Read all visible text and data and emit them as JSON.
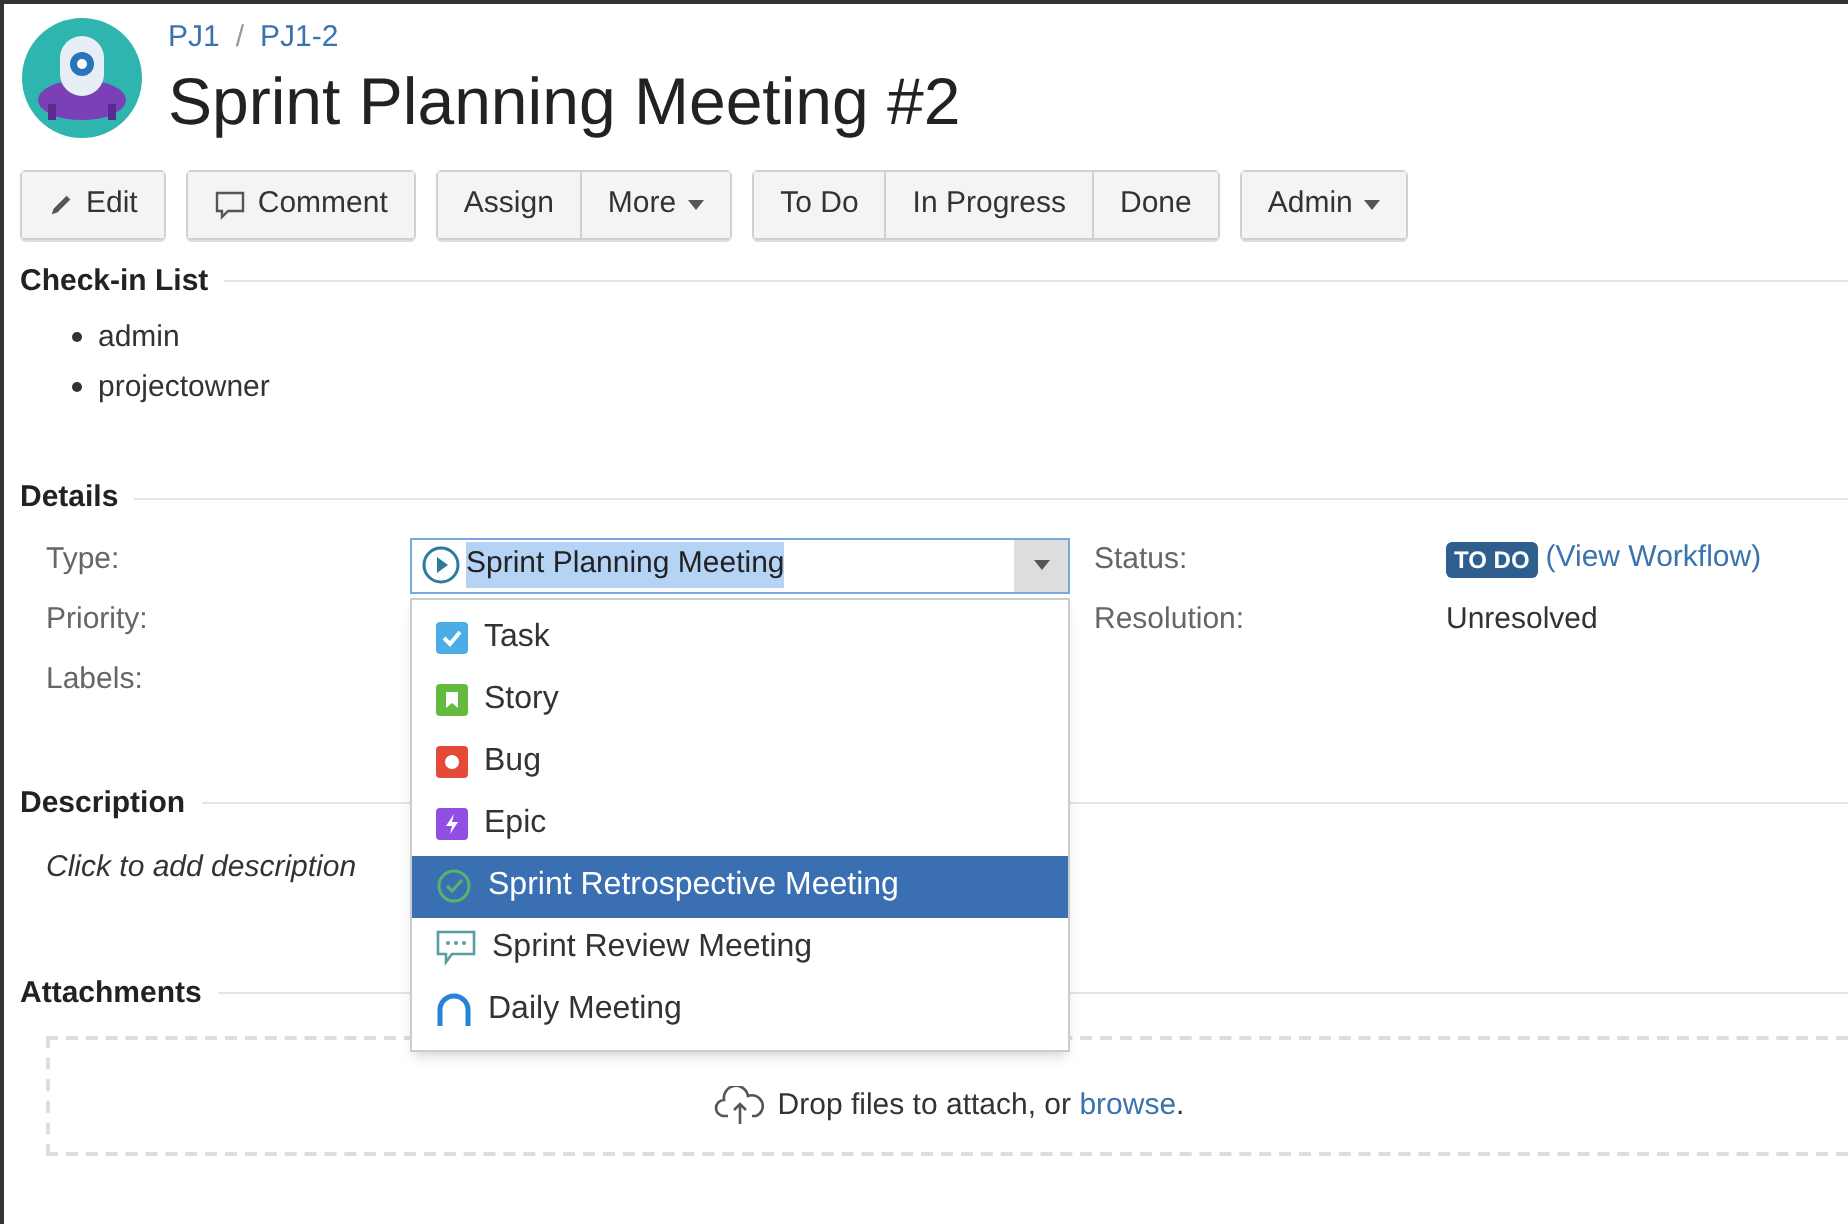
{
  "breadcrumbs": [
    "PJ1",
    "PJ1-2"
  ],
  "breadcrumb_separator": "/",
  "title": "Sprint Planning Meeting #2",
  "toolbar": [
    [
      {
        "label": "Edit",
        "kind": "edit"
      }
    ],
    [
      {
        "label": "Comment",
        "kind": "comment"
      }
    ],
    [
      {
        "label": "Assign",
        "kind": "plain"
      },
      {
        "label": "More",
        "kind": "menu"
      }
    ],
    [
      {
        "label": "To Do",
        "kind": "plain"
      },
      {
        "label": "In Progress",
        "kind": "plain"
      },
      {
        "label": "Done",
        "kind": "plain"
      }
    ],
    [
      {
        "label": "Admin",
        "kind": "menu"
      }
    ]
  ],
  "checkin": {
    "heading": "Check-in List",
    "items": [
      "admin",
      "projectowner"
    ]
  },
  "details": {
    "heading": "Details",
    "left": [
      {
        "label": "Type:"
      },
      {
        "label": "Priority:"
      },
      {
        "label": "Labels:"
      }
    ],
    "type_field": {
      "value": "Sprint Planning Meeting",
      "expanded": true,
      "options": [
        {
          "label": "Task",
          "kind": "task",
          "selected": false
        },
        {
          "label": "Story",
          "kind": "story",
          "selected": false
        },
        {
          "label": "Bug",
          "kind": "bug",
          "selected": false
        },
        {
          "label": "Epic",
          "kind": "epic",
          "selected": false
        },
        {
          "label": "Sprint Retrospective Meeting",
          "kind": "retro",
          "selected": true
        },
        {
          "label": "Sprint Review Meeting",
          "kind": "review",
          "selected": false
        },
        {
          "label": "Daily Meeting",
          "kind": "daily",
          "selected": false
        }
      ]
    },
    "status": {
      "label": "Status:",
      "badge": "TO DO",
      "link": "(View Workflow)"
    },
    "resolution": {
      "label": "Resolution:",
      "value": "Unresolved"
    }
  },
  "description": {
    "heading": "Description",
    "placeholder": "Click to add description"
  },
  "attachments": {
    "heading": "Attachments",
    "text": "Drop files to attach, or ",
    "link": "browse",
    "suffix": "."
  }
}
